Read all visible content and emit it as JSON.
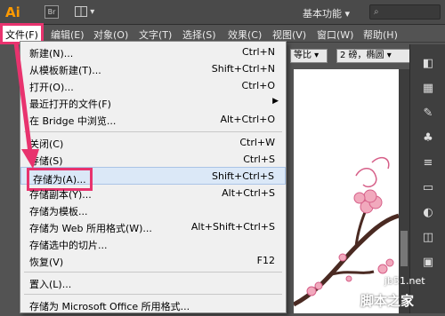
{
  "appbar": {
    "logo": "Ai",
    "bridge_icon": "Br",
    "workspace": "基本功能",
    "workspace_arrow": "▾",
    "search_placeholder": ""
  },
  "menubar": {
    "items": [
      "文件(F)",
      "编辑(E)",
      "对象(O)",
      "文字(T)",
      "选择(S)",
      "效果(C)",
      "视图(V)",
      "窗口(W)",
      "帮助(H)"
    ]
  },
  "controlbar": {
    "ratio_label": "等比",
    "stroke_value": "2 磅，椭圆"
  },
  "file_menu": {
    "items": [
      {
        "label": "新建(N)...",
        "shortcut": "Ctrl+N"
      },
      {
        "label": "从模板新建(T)...",
        "shortcut": "Shift+Ctrl+N"
      },
      {
        "label": "打开(O)...",
        "shortcut": "Ctrl+O"
      },
      {
        "label": "最近打开的文件(F)",
        "shortcut": "",
        "submenu": true
      },
      {
        "label": "在 Bridge 中浏览...",
        "shortcut": "Alt+Ctrl+O"
      },
      {
        "label": "关闭(C)",
        "shortcut": "Ctrl+W"
      },
      {
        "label": "存储(S)",
        "shortcut": "Ctrl+S"
      },
      {
        "label": "存储为(A)...",
        "shortcut": "Shift+Ctrl+S",
        "highlighted": true
      },
      {
        "label": "存储副本(Y)...",
        "shortcut": "Alt+Ctrl+S"
      },
      {
        "label": "存储为模板...",
        "shortcut": ""
      },
      {
        "label": "存储为 Web 所用格式(W)...",
        "shortcut": "Alt+Shift+Ctrl+S"
      },
      {
        "label": "存储选中的切片...",
        "shortcut": ""
      },
      {
        "label": "恢复(V)",
        "shortcut": "F12"
      },
      {
        "label": "置入(L)...",
        "shortcut": ""
      },
      {
        "label": "存储为 Microsoft Office 所用格式...",
        "shortcut": ""
      }
    ],
    "submenu_arrow": "▶"
  },
  "watermark": {
    "site": "jb51.net",
    "brand": "脚本之家"
  },
  "colors": {
    "highlight_box": "#e8336e",
    "menu_bg": "#f0f0f0",
    "ui_dark": "#535353"
  }
}
